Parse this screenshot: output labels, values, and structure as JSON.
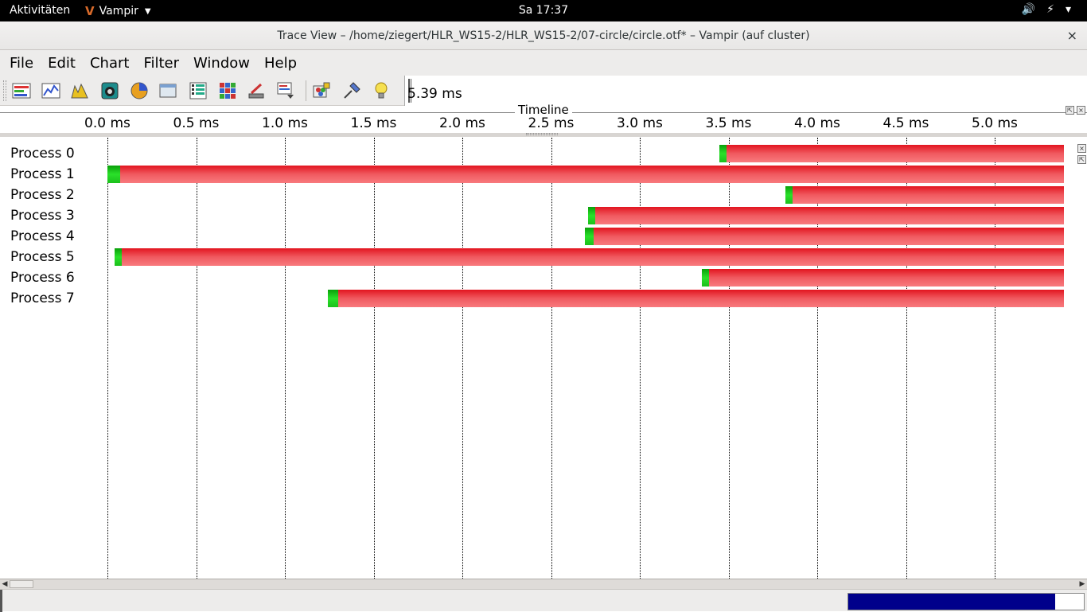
{
  "topbar": {
    "activities": "Aktivitäten",
    "app_name": "Vampir",
    "clock": "Sa 17:37",
    "tray_icons": [
      "volume-icon",
      "battery-icon",
      "power-menu-icon"
    ]
  },
  "window": {
    "title": "Trace View – /home/ziegert/HLR_WS15-2/HLR_WS15-2/07-circle/circle.otf* – Vampir (auf cluster)",
    "close_glyph": "×"
  },
  "menubar": {
    "items": [
      "File",
      "Edit",
      "Chart",
      "Filter",
      "Window",
      "Help"
    ]
  },
  "toolbar": {
    "icons": [
      "master-timeline-icon",
      "counter-timeline-icon",
      "performance-radar-icon",
      "process-timeline-icon",
      "function-summary-icon",
      "context-view-icon",
      "communication-matrix-icon",
      "message-summary-icon",
      "io-summary-icon",
      "call-tree-icon",
      "marker-view-icon",
      "process-summary-icon",
      "filter-groups-icon",
      "pin-icon",
      "hint-lightbulb-icon"
    ],
    "zoom_duration": "5.39 ms"
  },
  "timeline": {
    "title": "Timeline",
    "ticks": [
      "0.0 ms",
      "0.5 ms",
      "1.0 ms",
      "1.5 ms",
      "2.0 ms",
      "2.5 ms",
      "3.0 ms",
      "3.5 ms",
      "4.0 ms",
      "4.5 ms",
      "5.0 ms"
    ],
    "processes": [
      {
        "label": "Process 0",
        "green_start_ms": 3.45,
        "red_start_ms": 3.49,
        "end_ms": 5.39
      },
      {
        "label": "Process 1",
        "green_start_ms": 0.0,
        "red_start_ms": 0.07,
        "end_ms": 5.39
      },
      {
        "label": "Process 2",
        "green_start_ms": 3.82,
        "red_start_ms": 3.86,
        "end_ms": 5.39
      },
      {
        "label": "Process 3",
        "green_start_ms": 2.71,
        "red_start_ms": 2.75,
        "end_ms": 5.39
      },
      {
        "label": "Process 4",
        "green_start_ms": 2.69,
        "red_start_ms": 2.74,
        "end_ms": 5.39
      },
      {
        "label": "Process 5",
        "green_start_ms": 0.04,
        "red_start_ms": 0.08,
        "end_ms": 5.39
      },
      {
        "label": "Process 6",
        "green_start_ms": 3.35,
        "red_start_ms": 3.39,
        "end_ms": 5.39
      },
      {
        "label": "Process 7",
        "green_start_ms": 1.24,
        "red_start_ms": 1.3,
        "end_ms": 5.39
      }
    ],
    "colors": {
      "mpi": "#e2151f",
      "application": "#1cc01c"
    }
  },
  "statusbar": {
    "progress_fraction": 0.88
  }
}
